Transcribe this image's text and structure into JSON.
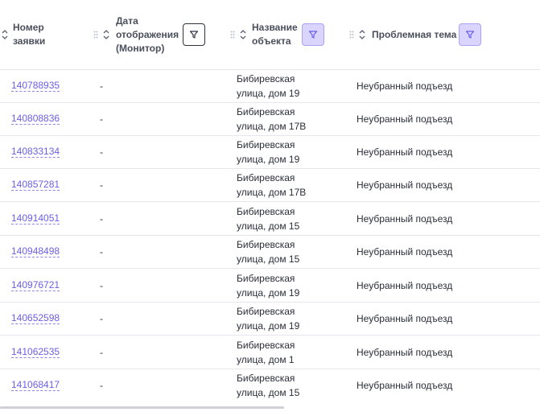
{
  "header": {
    "col1": {
      "label_line1": "Номер",
      "label_line2": "заявки"
    },
    "col2": {
      "label_line1": "Дата",
      "label_line2": "отображения",
      "label_line3": "(Монитор)"
    },
    "col3": {
      "label_line1": "Название",
      "label_line2": "объекта"
    },
    "col4": {
      "label_line1": "Проблемная тема"
    }
  },
  "icons": {
    "sort": "sort-up-down-icon",
    "drag": "drag-handle-icon",
    "filter": "funnel-filter-icon"
  },
  "colors": {
    "accent": "#6b5fe6",
    "filter_active_bg": "#d9d5ff",
    "filter_active_border": "#a9a2f5"
  },
  "rows": [
    {
      "id": "140788935",
      "date": "-",
      "addr1": "Бибиревская",
      "addr2": "улица, дом 19",
      "topic": "Неубранный подъезд"
    },
    {
      "id": "140808836",
      "date": "-",
      "addr1": "Бибиревская",
      "addr2": "улица, дом 17В",
      "topic": "Неубранный подъезд"
    },
    {
      "id": "140833134",
      "date": "-",
      "addr1": "Бибиревская",
      "addr2": "улица, дом 19",
      "topic": "Неубранный подъезд"
    },
    {
      "id": "140857281",
      "date": "-",
      "addr1": "Бибиревская",
      "addr2": "улица, дом 17В",
      "topic": "Неубранный подъезд"
    },
    {
      "id": "140914051",
      "date": "-",
      "addr1": "Бибиревская",
      "addr2": "улица, дом 15",
      "topic": "Неубранный подъезд"
    },
    {
      "id": "140948498",
      "date": "-",
      "addr1": "Бибиревская",
      "addr2": "улица, дом 15",
      "topic": "Неубранный подъезд"
    },
    {
      "id": "140976721",
      "date": "-",
      "addr1": "Бибиревская",
      "addr2": "улица, дом 19",
      "topic": "Неубранный подъезд"
    },
    {
      "id": "140652598",
      "date": "-",
      "addr1": "Бибиревская",
      "addr2": "улица, дом 19",
      "topic": "Неубранный подъезд"
    },
    {
      "id": "141062535",
      "date": "-",
      "addr1": "Бибиревская",
      "addr2": "улица, дом 1",
      "topic": "Неубранный подъезд"
    },
    {
      "id": "141068417",
      "date": "-",
      "addr1": "Бибиревская",
      "addr2": "улица, дом 15",
      "topic": "Неубранный подъезд"
    }
  ]
}
